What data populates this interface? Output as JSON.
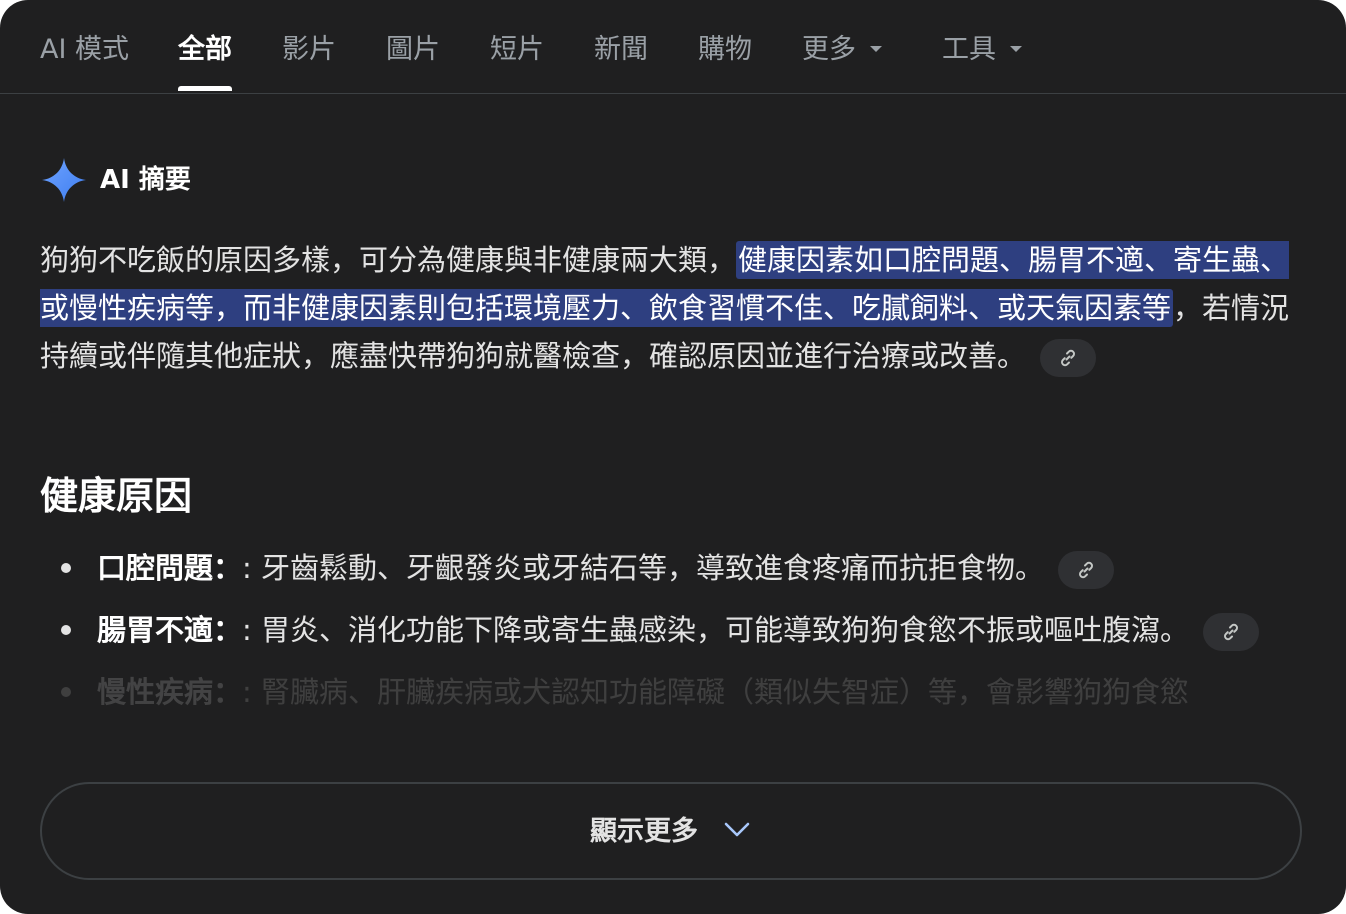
{
  "tabs": [
    {
      "label": "AI 模式",
      "active": false
    },
    {
      "label": "全部",
      "active": true
    },
    {
      "label": "影片",
      "active": false
    },
    {
      "label": "圖片",
      "active": false
    },
    {
      "label": "短片",
      "active": false
    },
    {
      "label": "新聞",
      "active": false
    },
    {
      "label": "購物",
      "active": false
    },
    {
      "label": "更多",
      "active": false,
      "has_dropdown": true
    },
    {
      "label": "工具",
      "active": false,
      "has_dropdown": true
    }
  ],
  "ai_overview": {
    "icon": "gemini-sparkle-icon",
    "title": "AI 摘要",
    "summary": {
      "before": "狗狗不吃飯的原因多樣，可分為健康與非健康兩大類，",
      "highlight": "健康因素如口腔問題、腸胃不適、寄生蟲、或慢性疾病等，而非健康因素則包括環境壓力、飲食習慣不佳、吃膩飼料、或天氣因素等",
      "after": "，若情況持續或伴隨其他症狀，應盡快帶狗狗就醫檢查，確認原因並進行治療或改善。"
    },
    "section_title": "健康原因",
    "bullets": [
      {
        "term": "口腔問題：",
        "text": ": 牙齒鬆動、牙齦發炎或牙結石等，導致進食疼痛而抗拒食物。",
        "has_link": true
      },
      {
        "term": "腸胃不適：",
        "text": ": 胃炎、消化功能下降或寄生蟲感染，可能導致狗狗食慾不振或嘔吐腹瀉。",
        "has_link": true
      },
      {
        "term": "慢性疾病：",
        "text": ": 腎臟病、肝臟疾病或犬認知功能障礙（類似失智症）等，會影響狗狗食慾",
        "has_link": false,
        "faded": true
      }
    ],
    "show_more_label": "顯示更多"
  },
  "colors": {
    "background": "#1f1f20",
    "highlight": "#2e3f80",
    "sparkle": "#4c8df6"
  }
}
